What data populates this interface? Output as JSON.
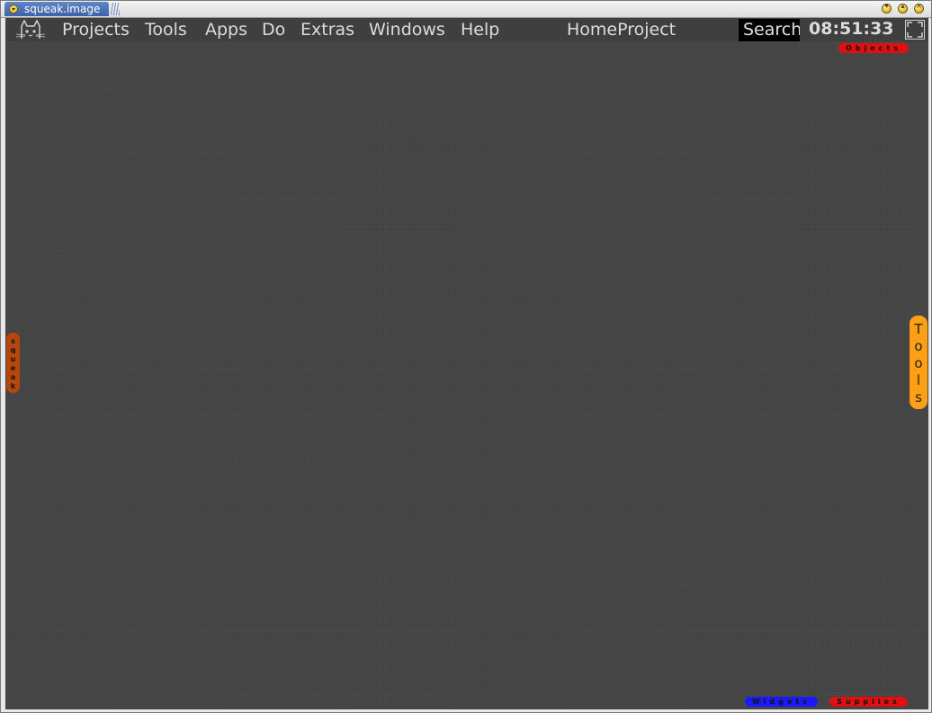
{
  "window": {
    "title": "squeak.image"
  },
  "menubar": {
    "items": [
      "Projects",
      "Tools",
      "Apps",
      "Do",
      "Extras",
      "Windows",
      "Help"
    ],
    "project_name": "HomeProject",
    "search_placeholder": "Search",
    "clock": "08:51:33",
    "logo_icon": "squeak-cat-logo-icon",
    "fullscreen_icon": "fullscreen-icon"
  },
  "flaps": {
    "objects": "Objects",
    "squeak": "squeak",
    "tools": "Tools",
    "widgets": "Widgets",
    "supplies": "Supplies"
  },
  "colors": {
    "menubar_bg": "#3f3f3f",
    "world_bg": "#454545",
    "objects_flap": "#e01010",
    "squeak_flap": "#b5460c",
    "tools_flap": "#ff9f14",
    "widgets_flap": "#1a1aff",
    "supplies_flap": "#e01010",
    "title_tab": "#4a72b8"
  }
}
